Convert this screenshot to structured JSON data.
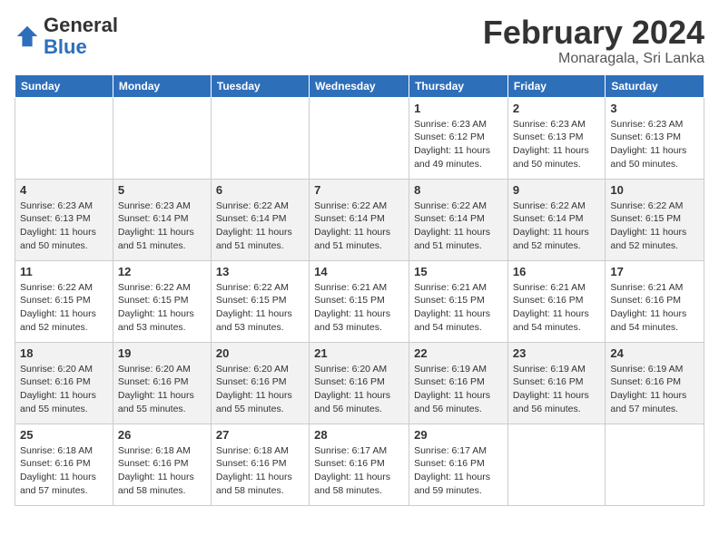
{
  "header": {
    "logo_general": "General",
    "logo_blue": "Blue",
    "month_year": "February 2024",
    "location": "Monaragala, Sri Lanka"
  },
  "days_of_week": [
    "Sunday",
    "Monday",
    "Tuesday",
    "Wednesday",
    "Thursday",
    "Friday",
    "Saturday"
  ],
  "weeks": [
    [
      {
        "day": "",
        "sunrise": "",
        "sunset": "",
        "daylight": ""
      },
      {
        "day": "",
        "sunrise": "",
        "sunset": "",
        "daylight": ""
      },
      {
        "day": "",
        "sunrise": "",
        "sunset": "",
        "daylight": ""
      },
      {
        "day": "",
        "sunrise": "",
        "sunset": "",
        "daylight": ""
      },
      {
        "day": "1",
        "sunrise": "6:23 AM",
        "sunset": "6:12 PM",
        "daylight": "11 hours and 49 minutes."
      },
      {
        "day": "2",
        "sunrise": "6:23 AM",
        "sunset": "6:13 PM",
        "daylight": "11 hours and 50 minutes."
      },
      {
        "day": "3",
        "sunrise": "6:23 AM",
        "sunset": "6:13 PM",
        "daylight": "11 hours and 50 minutes."
      }
    ],
    [
      {
        "day": "4",
        "sunrise": "6:23 AM",
        "sunset": "6:13 PM",
        "daylight": "11 hours and 50 minutes."
      },
      {
        "day": "5",
        "sunrise": "6:23 AM",
        "sunset": "6:14 PM",
        "daylight": "11 hours and 51 minutes."
      },
      {
        "day": "6",
        "sunrise": "6:22 AM",
        "sunset": "6:14 PM",
        "daylight": "11 hours and 51 minutes."
      },
      {
        "day": "7",
        "sunrise": "6:22 AM",
        "sunset": "6:14 PM",
        "daylight": "11 hours and 51 minutes."
      },
      {
        "day": "8",
        "sunrise": "6:22 AM",
        "sunset": "6:14 PM",
        "daylight": "11 hours and 51 minutes."
      },
      {
        "day": "9",
        "sunrise": "6:22 AM",
        "sunset": "6:14 PM",
        "daylight": "11 hours and 52 minutes."
      },
      {
        "day": "10",
        "sunrise": "6:22 AM",
        "sunset": "6:15 PM",
        "daylight": "11 hours and 52 minutes."
      }
    ],
    [
      {
        "day": "11",
        "sunrise": "6:22 AM",
        "sunset": "6:15 PM",
        "daylight": "11 hours and 52 minutes."
      },
      {
        "day": "12",
        "sunrise": "6:22 AM",
        "sunset": "6:15 PM",
        "daylight": "11 hours and 53 minutes."
      },
      {
        "day": "13",
        "sunrise": "6:22 AM",
        "sunset": "6:15 PM",
        "daylight": "11 hours and 53 minutes."
      },
      {
        "day": "14",
        "sunrise": "6:21 AM",
        "sunset": "6:15 PM",
        "daylight": "11 hours and 53 minutes."
      },
      {
        "day": "15",
        "sunrise": "6:21 AM",
        "sunset": "6:15 PM",
        "daylight": "11 hours and 54 minutes."
      },
      {
        "day": "16",
        "sunrise": "6:21 AM",
        "sunset": "6:16 PM",
        "daylight": "11 hours and 54 minutes."
      },
      {
        "day": "17",
        "sunrise": "6:21 AM",
        "sunset": "6:16 PM",
        "daylight": "11 hours and 54 minutes."
      }
    ],
    [
      {
        "day": "18",
        "sunrise": "6:20 AM",
        "sunset": "6:16 PM",
        "daylight": "11 hours and 55 minutes."
      },
      {
        "day": "19",
        "sunrise": "6:20 AM",
        "sunset": "6:16 PM",
        "daylight": "11 hours and 55 minutes."
      },
      {
        "day": "20",
        "sunrise": "6:20 AM",
        "sunset": "6:16 PM",
        "daylight": "11 hours and 55 minutes."
      },
      {
        "day": "21",
        "sunrise": "6:20 AM",
        "sunset": "6:16 PM",
        "daylight": "11 hours and 56 minutes."
      },
      {
        "day": "22",
        "sunrise": "6:19 AM",
        "sunset": "6:16 PM",
        "daylight": "11 hours and 56 minutes."
      },
      {
        "day": "23",
        "sunrise": "6:19 AM",
        "sunset": "6:16 PM",
        "daylight": "11 hours and 56 minutes."
      },
      {
        "day": "24",
        "sunrise": "6:19 AM",
        "sunset": "6:16 PM",
        "daylight": "11 hours and 57 minutes."
      }
    ],
    [
      {
        "day": "25",
        "sunrise": "6:18 AM",
        "sunset": "6:16 PM",
        "daylight": "11 hours and 57 minutes."
      },
      {
        "day": "26",
        "sunrise": "6:18 AM",
        "sunset": "6:16 PM",
        "daylight": "11 hours and 58 minutes."
      },
      {
        "day": "27",
        "sunrise": "6:18 AM",
        "sunset": "6:16 PM",
        "daylight": "11 hours and 58 minutes."
      },
      {
        "day": "28",
        "sunrise": "6:17 AM",
        "sunset": "6:16 PM",
        "daylight": "11 hours and 58 minutes."
      },
      {
        "day": "29",
        "sunrise": "6:17 AM",
        "sunset": "6:16 PM",
        "daylight": "11 hours and 59 minutes."
      },
      {
        "day": "",
        "sunrise": "",
        "sunset": "",
        "daylight": ""
      },
      {
        "day": "",
        "sunrise": "",
        "sunset": "",
        "daylight": ""
      }
    ]
  ]
}
